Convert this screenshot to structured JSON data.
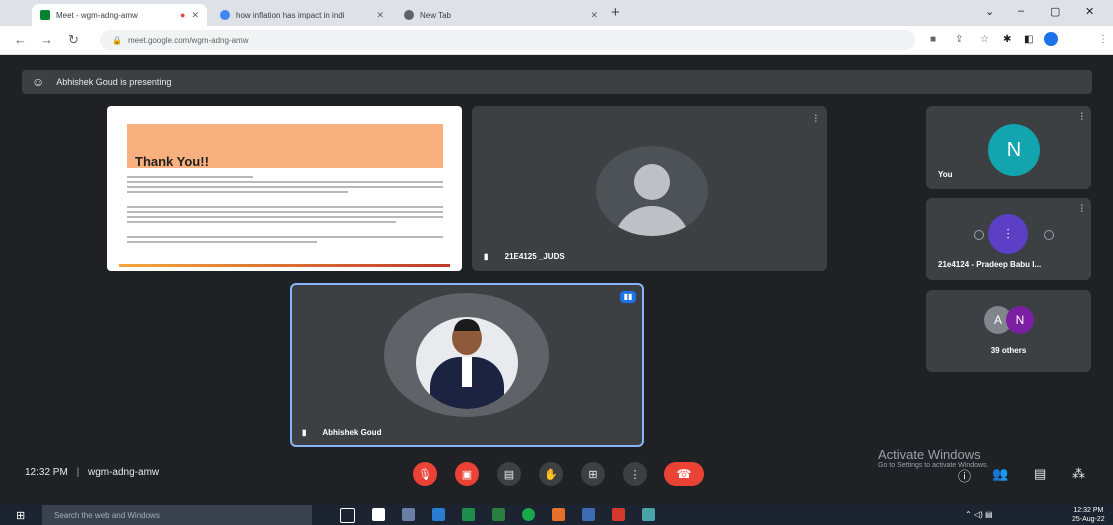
{
  "browser": {
    "tabs": [
      {
        "title": "Meet - wgm-adng-amw",
        "active": true
      },
      {
        "title": "how inflation has impact in indi",
        "active": false
      },
      {
        "title": "New Tab",
        "active": false
      }
    ],
    "new_tab_symbol": "+",
    "url": "meet.google.com/wgm-adng-amw",
    "window_controls": [
      "–",
      "▢",
      "✕"
    ]
  },
  "meet": {
    "presenting_text": "Abhishek Goud is presenting",
    "slide": {
      "heading": "Thank You!!"
    },
    "tiles": {
      "participant_name": "21E4125 _JUDS",
      "active_speaker_name": "Abhishek Goud"
    },
    "side": {
      "you": {
        "initial": "N",
        "label": "You"
      },
      "pradeep": {
        "label": "21e4124 - Pradeep Babu I..."
      },
      "others": {
        "initials": [
          "A",
          "N"
        ],
        "label": "39 others"
      }
    },
    "footer": {
      "time": "12:32 PM",
      "separator": "|",
      "meeting_code": "wgm-adng-amw"
    },
    "activate": {
      "title": "Activate Windows",
      "subtitle": "Go to Settings to activate Windows."
    }
  },
  "taskbar": {
    "search_placeholder": "Search the web and Windows",
    "clock_time": "12:32 PM",
    "clock_date": "25-Aug-22"
  },
  "colors": {
    "meet_bg": "#202124",
    "tile_bg": "#3c4043",
    "end_call": "#ea4335",
    "you_avatar": "#12a4af",
    "accent_border": "#8ab4f8"
  }
}
